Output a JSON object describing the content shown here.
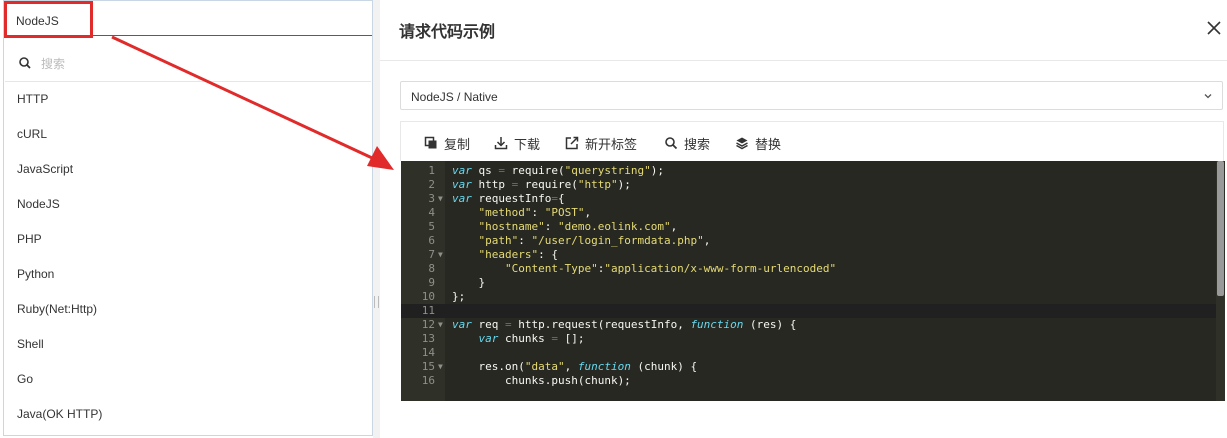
{
  "left_panel": {
    "selected_value": "NodeJS",
    "search_placeholder": "搜索",
    "options": [
      "HTTP",
      "cURL",
      "JavaScript",
      "NodeJS",
      "PHP",
      "Python",
      "Ruby(Net:Http)",
      "Shell",
      "Go",
      "Java(OK HTTP)"
    ]
  },
  "modal": {
    "title": "请求代码示例",
    "selected_language": "NodeJS / Native",
    "toolbar": {
      "copy": "复制",
      "download": "下载",
      "new_tab": "新开标签",
      "search": "搜索",
      "replace": "替换"
    },
    "code_lines": [
      {
        "n": "1",
        "fold": false
      },
      {
        "n": "2",
        "fold": false
      },
      {
        "n": "3",
        "fold": true
      },
      {
        "n": "4",
        "fold": false
      },
      {
        "n": "5",
        "fold": false
      },
      {
        "n": "6",
        "fold": false
      },
      {
        "n": "7",
        "fold": true
      },
      {
        "n": "8",
        "fold": false
      },
      {
        "n": "9",
        "fold": false
      },
      {
        "n": "10",
        "fold": false
      },
      {
        "n": "11",
        "fold": false
      },
      {
        "n": "12",
        "fold": true
      },
      {
        "n": "13",
        "fold": false
      },
      {
        "n": "14",
        "fold": false
      },
      {
        "n": "15",
        "fold": true
      },
      {
        "n": "16",
        "fold": false
      }
    ]
  },
  "colors": {
    "highlight": "#e12a2a",
    "editor_bg": "#272822",
    "keyword": "#66d9ef",
    "string": "#e6db74",
    "operator": "#f92672"
  }
}
